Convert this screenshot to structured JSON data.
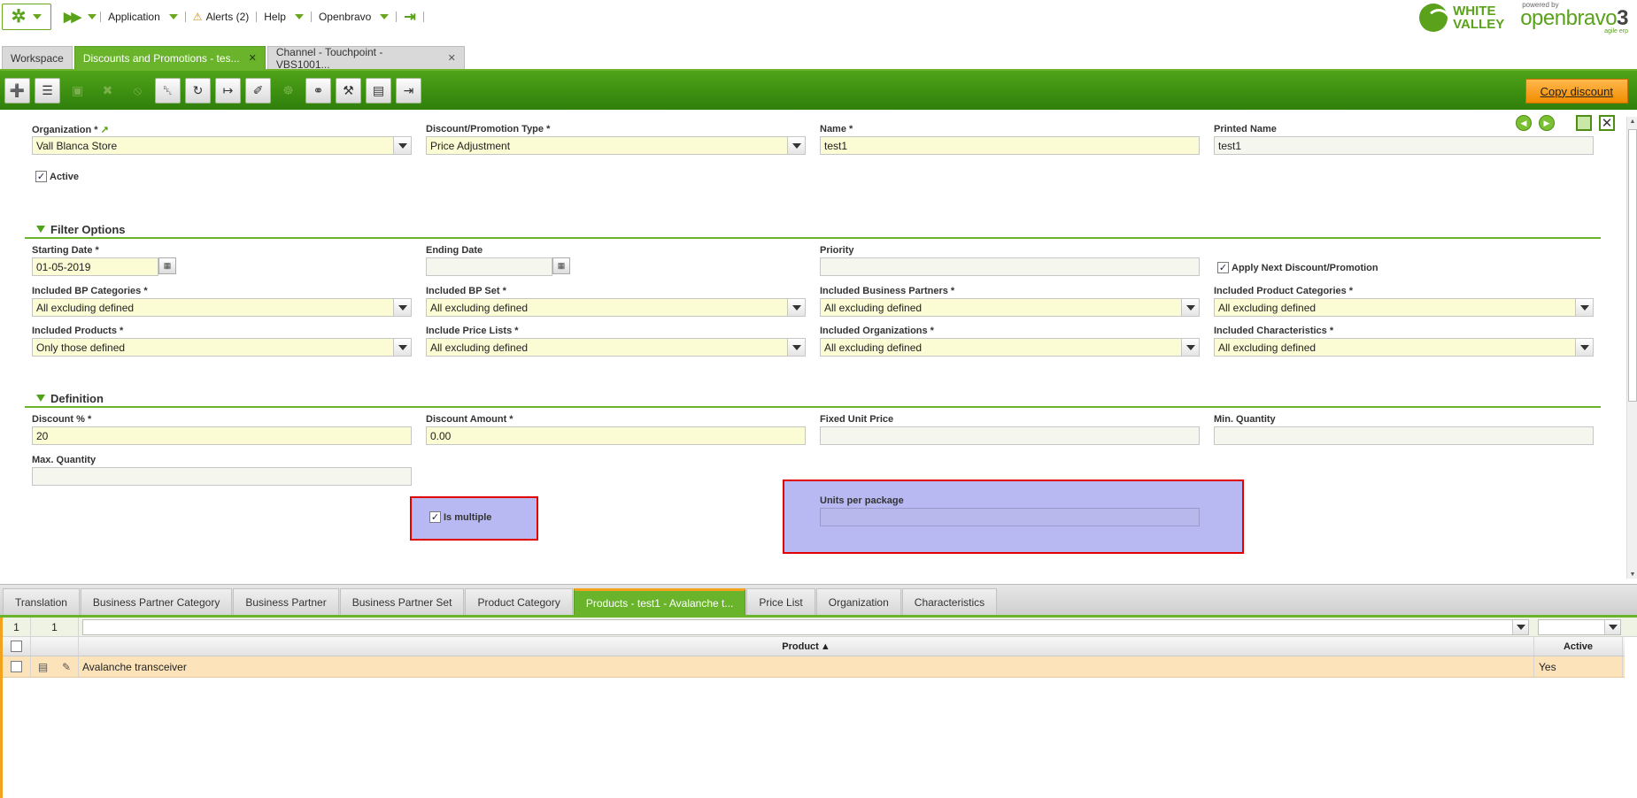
{
  "topnav": {
    "application": "Application",
    "alerts": "Alerts (2)",
    "help": "Help",
    "user": "Openbravo"
  },
  "logos": {
    "brand_line1": "WHITE",
    "brand_line2": "VALLEY",
    "powered_by": "powered by",
    "product_open": "open",
    "product_bravo": "bravo",
    "product_version": "3",
    "tagline": "agile erp"
  },
  "window_tabs": [
    {
      "label": "Workspace",
      "closable": false,
      "active": false
    },
    {
      "label": "Discounts and Promotions - tes...",
      "closable": true,
      "active": true
    },
    {
      "label": "Channel - Touchpoint - VBS1001...",
      "closable": true,
      "active": false
    }
  ],
  "toolbar": {
    "buttons": [
      {
        "icon": "new-document-icon",
        "glyph": "➕",
        "enabled": true
      },
      {
        "icon": "new-row-icon",
        "glyph": "☰",
        "enabled": true
      },
      {
        "icon": "save-icon",
        "glyph": "▣",
        "enabled": false
      },
      {
        "icon": "save-close-icon",
        "glyph": "✖",
        "enabled": false
      },
      {
        "icon": "undo-icon",
        "glyph": "⦸",
        "enabled": false
      },
      {
        "icon": "delete-icon",
        "glyph": "␡",
        "enabled": true
      },
      {
        "icon": "refresh-icon",
        "glyph": "↻",
        "enabled": true
      },
      {
        "icon": "export-icon",
        "glyph": "↦",
        "enabled": true
      },
      {
        "icon": "attach-icon",
        "glyph": "✐",
        "enabled": true
      },
      {
        "icon": "workflow-icon",
        "glyph": "☸",
        "enabled": false
      },
      {
        "icon": "link-icon",
        "glyph": "⚭",
        "enabled": true
      },
      {
        "icon": "audit-icon",
        "glyph": "⚒",
        "enabled": true
      },
      {
        "icon": "grid-view-icon",
        "glyph": "▤",
        "enabled": true
      },
      {
        "icon": "print-icon",
        "glyph": "⇥",
        "enabled": true
      }
    ],
    "copy_discount": "Copy discount"
  },
  "form": {
    "organization": {
      "label": "Organization *",
      "value": "Vall Blanca Store"
    },
    "discount_type": {
      "label": "Discount/Promotion Type *",
      "value": "Price Adjustment"
    },
    "name": {
      "label": "Name *",
      "value": "test1"
    },
    "printed_name": {
      "label": "Printed Name",
      "value": "test1"
    },
    "active": {
      "label": "Active",
      "checked": true
    },
    "filter_section": "Filter Options",
    "starting_date": {
      "label": "Starting Date *",
      "value": "01-05-2019"
    },
    "ending_date": {
      "label": "Ending Date",
      "value": ""
    },
    "priority": {
      "label": "Priority",
      "value": ""
    },
    "apply_next": {
      "label": "Apply Next Discount/Promotion",
      "checked": true
    },
    "bp_categories": {
      "label": "Included BP Categories *",
      "value": "All excluding defined"
    },
    "bp_set": {
      "label": "Included BP Set *",
      "value": "All excluding defined"
    },
    "business_partners": {
      "label": "Included Business Partners *",
      "value": "All excluding defined"
    },
    "product_categories": {
      "label": "Included Product Categories *",
      "value": "All excluding defined"
    },
    "products": {
      "label": "Included Products *",
      "value": "Only those defined"
    },
    "price_lists": {
      "label": "Include Price Lists *",
      "value": "All excluding defined"
    },
    "organizations": {
      "label": "Included Organizations *",
      "value": "All excluding defined"
    },
    "characteristics": {
      "label": "Included Characteristics *",
      "value": "All excluding defined"
    },
    "definition_section": "Definition",
    "discount_pct": {
      "label": "Discount % *",
      "value": "20"
    },
    "discount_amount": {
      "label": "Discount Amount *",
      "value": "0.00"
    },
    "fixed_unit_price": {
      "label": "Fixed Unit Price",
      "value": ""
    },
    "min_quantity": {
      "label": "Min. Quantity",
      "value": ""
    },
    "max_quantity": {
      "label": "Max. Quantity",
      "value": ""
    },
    "is_multiple": {
      "label": "Is multiple",
      "checked": true
    },
    "units_per_package": {
      "label": "Units per package",
      "value": ""
    }
  },
  "subtabs": [
    {
      "label": "Translation",
      "active": false
    },
    {
      "label": "Business Partner Category",
      "active": false
    },
    {
      "label": "Business Partner",
      "active": false
    },
    {
      "label": "Business Partner Set",
      "active": false
    },
    {
      "label": "Product Category",
      "active": false
    },
    {
      "label": "Products - test1 - Avalanche t...",
      "active": true
    },
    {
      "label": "Price List",
      "active": false
    },
    {
      "label": "Organization",
      "active": false
    },
    {
      "label": "Characteristics",
      "active": false
    }
  ],
  "grid": {
    "selected_count": "1",
    "total_count": "1",
    "columns": {
      "product": "Product",
      "product_sort": "▲",
      "active": "Active"
    },
    "rows": [
      {
        "product": "Avalanche transceiver",
        "active": "Yes"
      }
    ]
  }
}
